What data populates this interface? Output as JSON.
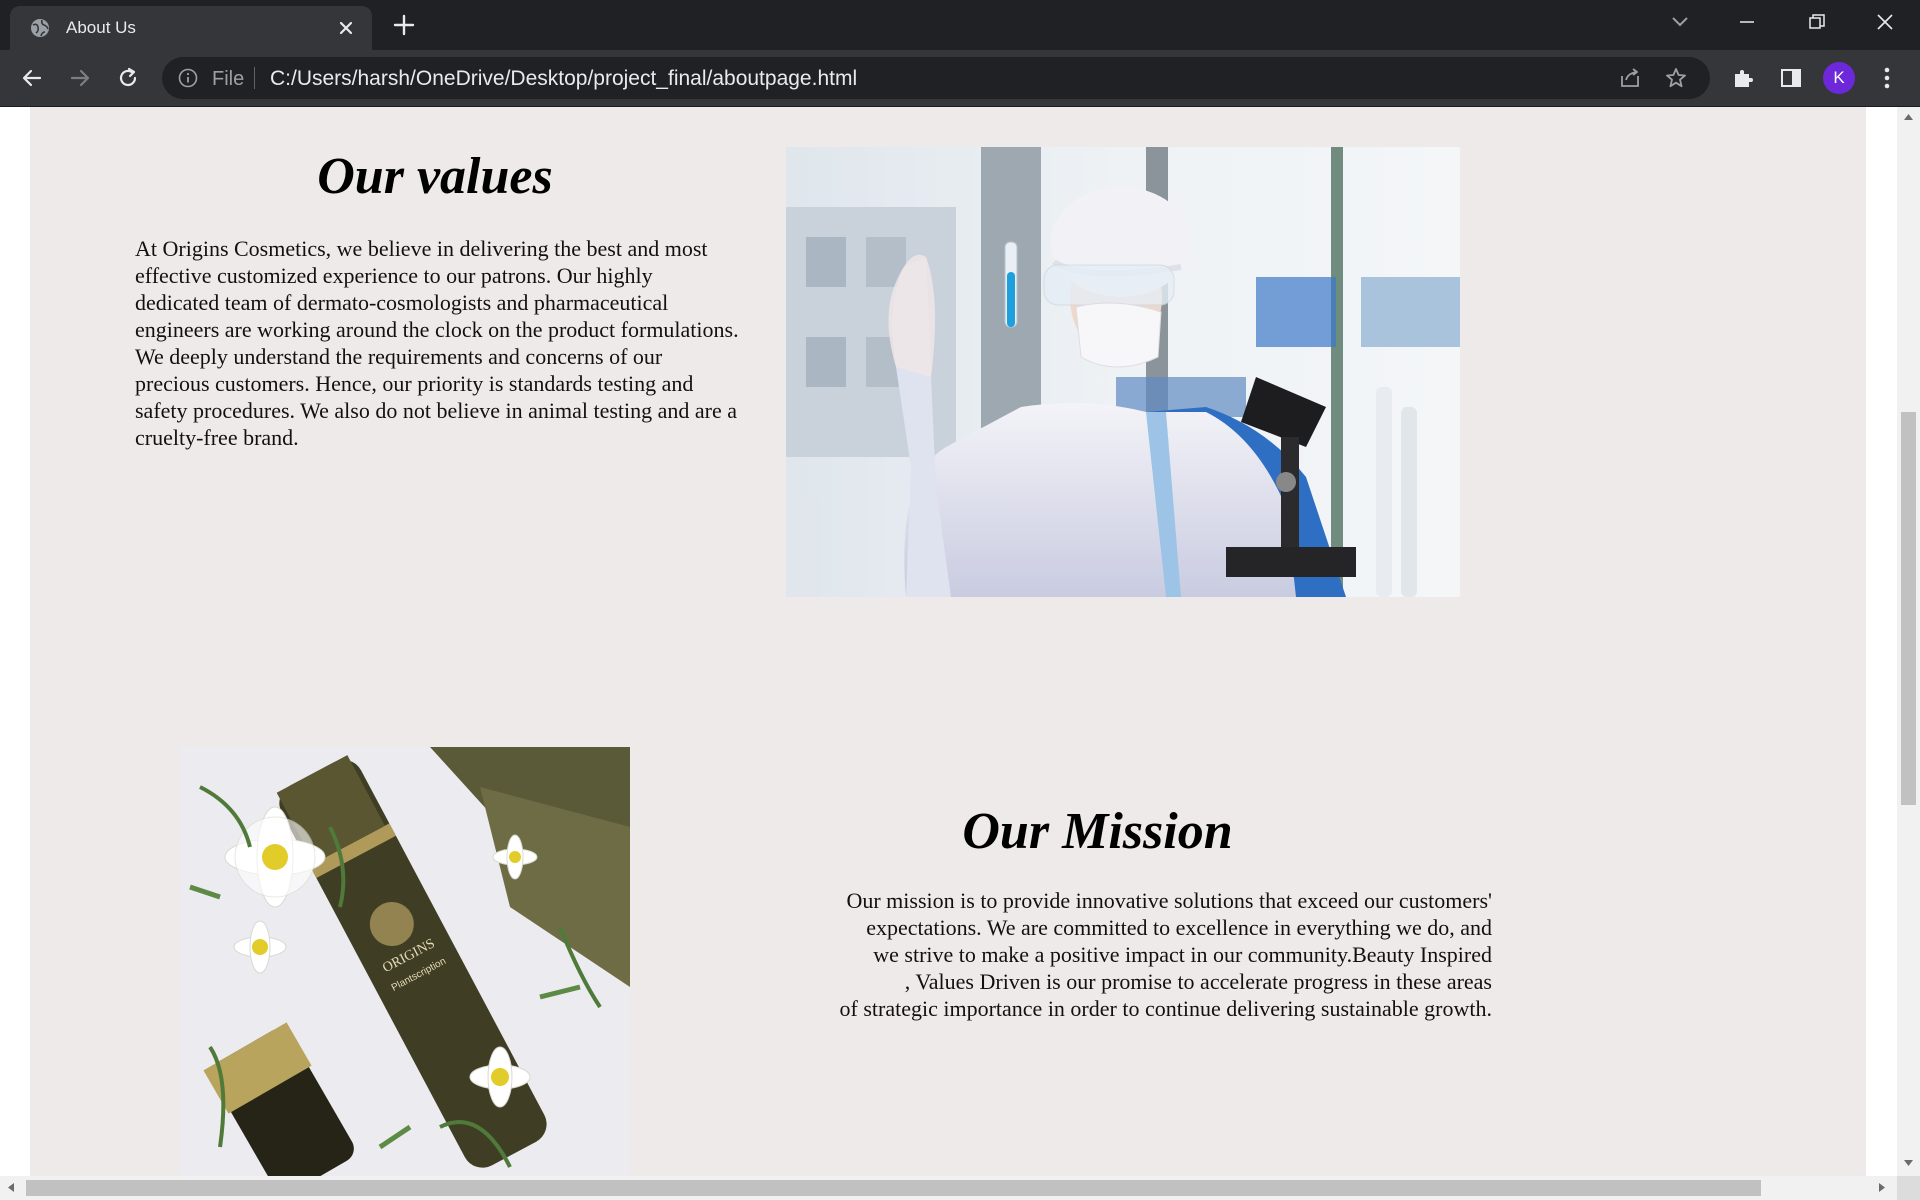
{
  "tab": {
    "title": "About Us",
    "favicon": "globe-icon"
  },
  "omnibox": {
    "scheme_label": "File",
    "url": "C:/Users/harsh/OneDrive/Desktop/project_final/aboutpage.html"
  },
  "profile": {
    "initial": "K",
    "color": "#6d28d9"
  },
  "values": {
    "heading": "Our values",
    "text": "At Origins Cosmetics, we believe in delivering the best and most effective customized experience to our patrons. Our highly dedicated team of dermato-cosmologists and pharmaceutical engineers are working around the clock on the product formulations. We deeply understand the requirements and concerns of our precious customers. Hence, our priority is standards testing and safety procedures. We also do not believe in animal testing and are a cruelty-free brand.",
    "image": "scientist-holding-test-tube-photo"
  },
  "mission": {
    "heading": "Our Mission",
    "lines": [
      "Our mission is to provide innovative solutions that exceed our customers'",
      "expectations. We are committed to excellence in everything we do, and",
      "we strive to make a positive impact in our community.Beauty Inspired",
      ", Values Driven is our promise to accelerate progress in these areas",
      "of strategic importance in order to continue delivering sustainable growth."
    ],
    "image": "origins-bottles-with-daisies-photo",
    "product_brand": "ORIGINS",
    "product_name": "Plantscription"
  },
  "colors": {
    "page_background": "#efeaea",
    "browser_frame": "#202124",
    "toolbar": "#35363a"
  }
}
